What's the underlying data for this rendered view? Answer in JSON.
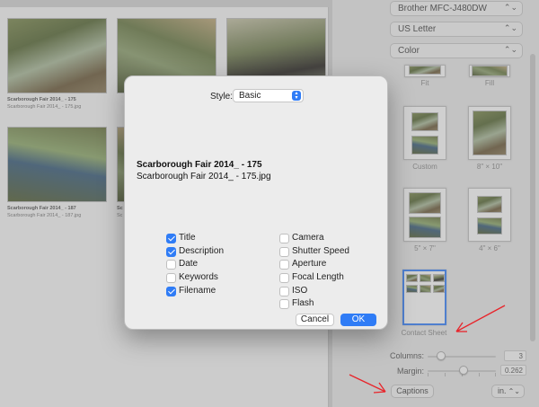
{
  "preview": {
    "thumbs": [
      {
        "title": "Scarborough Fair 2014_ - 175",
        "file": "Scarborough Fair 2014_ - 175.jpg"
      },
      {
        "title": "",
        "file": ""
      },
      {
        "title": "",
        "file": ""
      },
      {
        "title": "Scarborough Fair 2014_ - 187",
        "file": "Scarborough Fair 2014_ - 187.jpg"
      },
      {
        "title": "Sc",
        "file": "Sc"
      }
    ]
  },
  "panel": {
    "printer": "Brother MFC-J480DW",
    "paper": "US Letter",
    "color": "Color",
    "layouts": [
      {
        "label": "Fit"
      },
      {
        "label": "Fill"
      },
      {
        "label": "Custom"
      },
      {
        "label": "8\" × 10\""
      },
      {
        "label": "5\" × 7\""
      },
      {
        "label": "4\" × 6\""
      },
      {
        "label": "Contact Sheet"
      }
    ],
    "columns_label": "Columns:",
    "columns_value": "3",
    "margin_label": "Margin:",
    "margin_value": "0.262",
    "captions_button": "Captions",
    "units": "in."
  },
  "dialog": {
    "style_label": "Style:",
    "style_value": "Basic",
    "preview_title": "Scarborough Fair 2014_ - 175",
    "preview_file": "Scarborough Fair 2014_ - 175.jpg",
    "left_options": [
      {
        "label": "Title",
        "checked": true
      },
      {
        "label": "Description",
        "checked": true
      },
      {
        "label": "Date",
        "checked": false
      },
      {
        "label": "Keywords",
        "checked": false
      },
      {
        "label": "Filename",
        "checked": true
      }
    ],
    "right_options": [
      {
        "label": "Camera",
        "checked": false
      },
      {
        "label": "Shutter Speed",
        "checked": false
      },
      {
        "label": "Aperture",
        "checked": false
      },
      {
        "label": "Focal Length",
        "checked": false
      },
      {
        "label": "ISO",
        "checked": false
      },
      {
        "label": "Flash",
        "checked": false
      }
    ],
    "cancel": "Cancel",
    "ok": "OK"
  },
  "colors": {
    "accent": "#2f7cf6",
    "annotation": "#e8242a"
  }
}
